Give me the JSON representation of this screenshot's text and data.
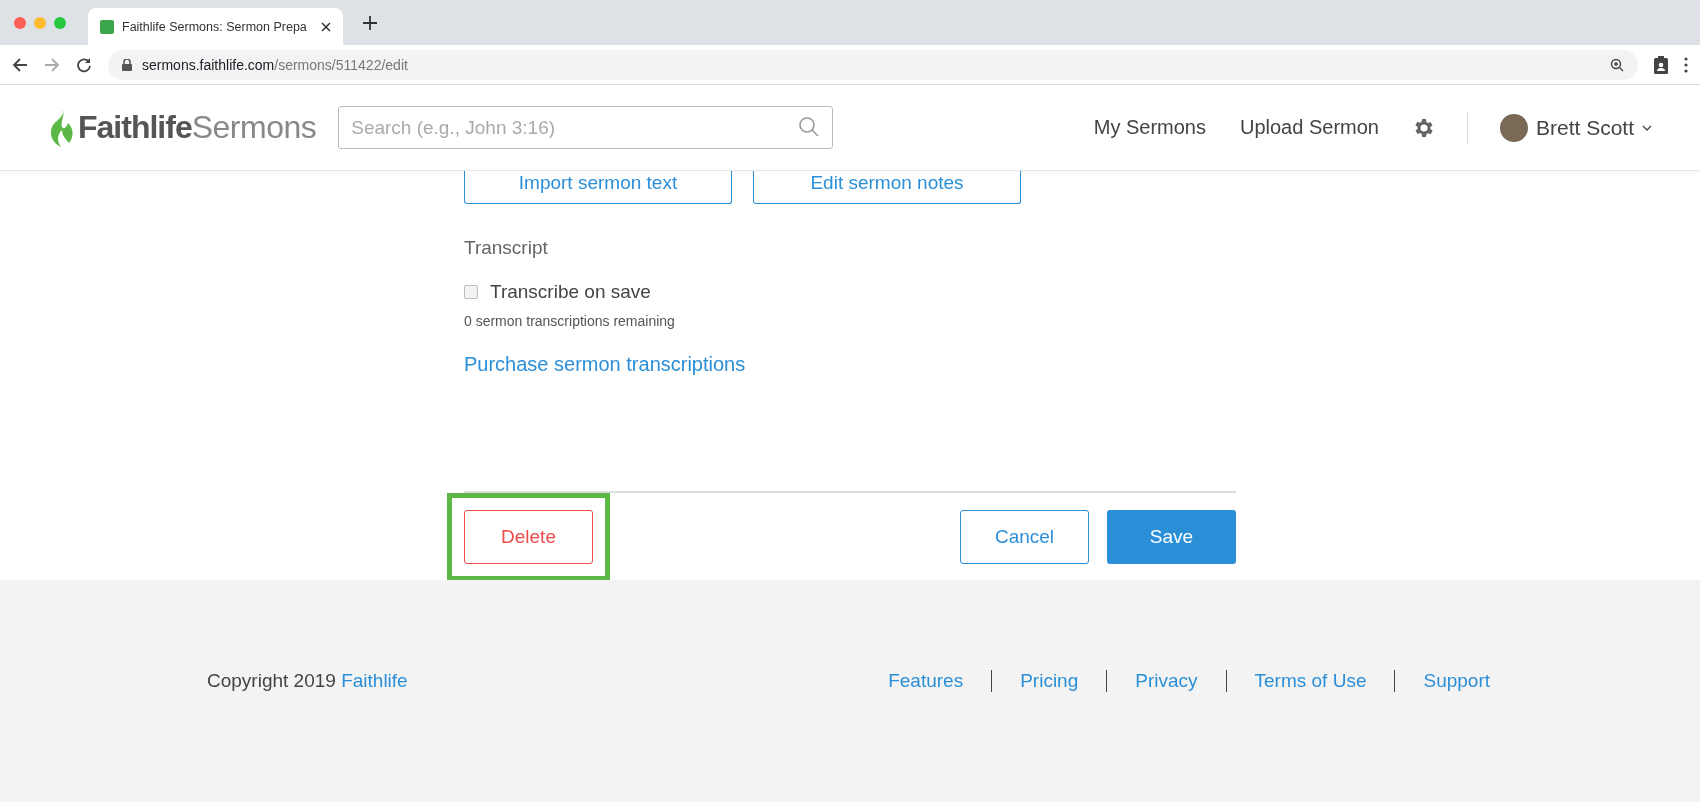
{
  "browser": {
    "tab_title": "Faithlife Sermons: Sermon Prepa",
    "url_host": "sermons.faithlife.com",
    "url_path": "/sermons/511422/edit"
  },
  "header": {
    "logo_bold": "Faithlife",
    "logo_light": "Sermons",
    "search": {
      "placeholder": "Search (e.g., John 3:16)"
    },
    "nav": [
      "My Sermons",
      "Upload Sermon"
    ],
    "user": "Brett Scott"
  },
  "content": {
    "top_buttons": [
      "Import sermon text",
      "Edit sermon notes"
    ],
    "section_title": "Transcript",
    "transcribe": {
      "label": "Transcribe on save",
      "checked": false
    },
    "remaining": "0 sermon transcriptions remaining",
    "purchase_link": "Purchase sermon transcriptions",
    "delete_button": "Delete",
    "delete_highlighted": true,
    "cancel_button": "Cancel",
    "save_button": "Save"
  },
  "footer": {
    "copyright": "Copyright 2019",
    "copyright_link": "Faithlife",
    "links": [
      "Features",
      "Pricing",
      "Privacy",
      "Terms of Use",
      "Support"
    ]
  }
}
